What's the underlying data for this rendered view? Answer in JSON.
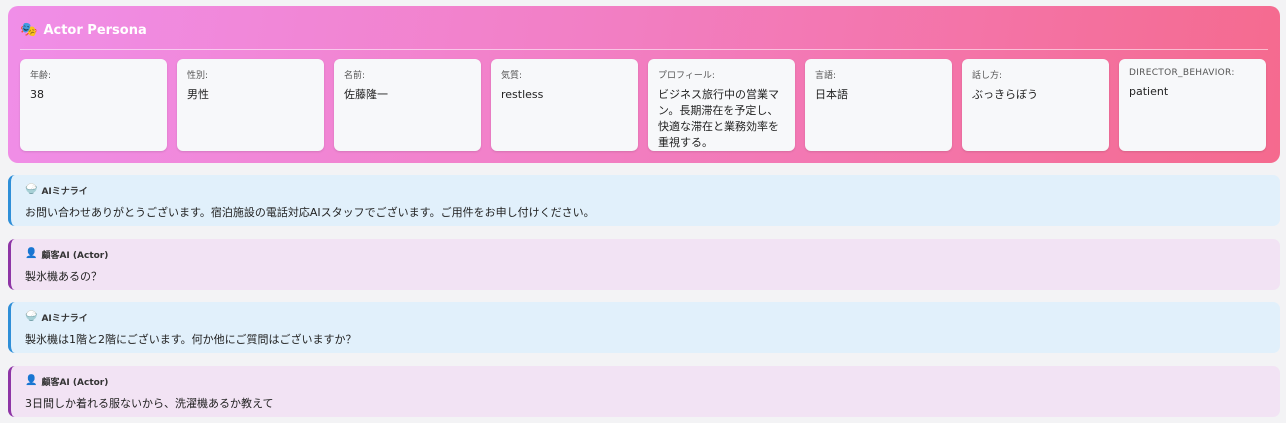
{
  "persona": {
    "title": "Actor Persona",
    "icon": "theater-masks-icon",
    "fields": [
      {
        "label": "年齢:",
        "value": "38"
      },
      {
        "label": "性別:",
        "value": "男性"
      },
      {
        "label": "名前:",
        "value": "佐藤隆一"
      },
      {
        "label": "気質:",
        "value": "restless"
      },
      {
        "label": "プロフィール:",
        "value": "ビジネス旅行中の営業マン。長期滞在を予定し、快適な滞在と業務効率を重視する。"
      },
      {
        "label": "言語:",
        "value": "日本語"
      },
      {
        "label": "話し方:",
        "value": "ぶっきらぼう"
      },
      {
        "label": "DIRECTOR_BEHAVIOR:",
        "value": "patient"
      }
    ]
  },
  "messages": [
    {
      "role": "ai",
      "speaker": "AIミナライ",
      "icon": "robot-icon",
      "text": "お問い合わせありがとうございます。宿泊施設の電話対応AIスタッフでございます。ご用件をお申し付けください。"
    },
    {
      "role": "actor",
      "speaker": "顧客AI (Actor)",
      "icon": "person-icon",
      "text": "製氷機あるの？"
    },
    {
      "role": "ai",
      "speaker": "AIミナライ",
      "icon": "robot-icon",
      "text": "製氷機は1階と2階にございます。何か他にご質問はございますか？"
    },
    {
      "role": "actor",
      "speaker": "顧客AI (Actor)",
      "icon": "person-icon",
      "text": "3日間しか着れる服ないから、洗濯機あるか教えて"
    }
  ]
}
